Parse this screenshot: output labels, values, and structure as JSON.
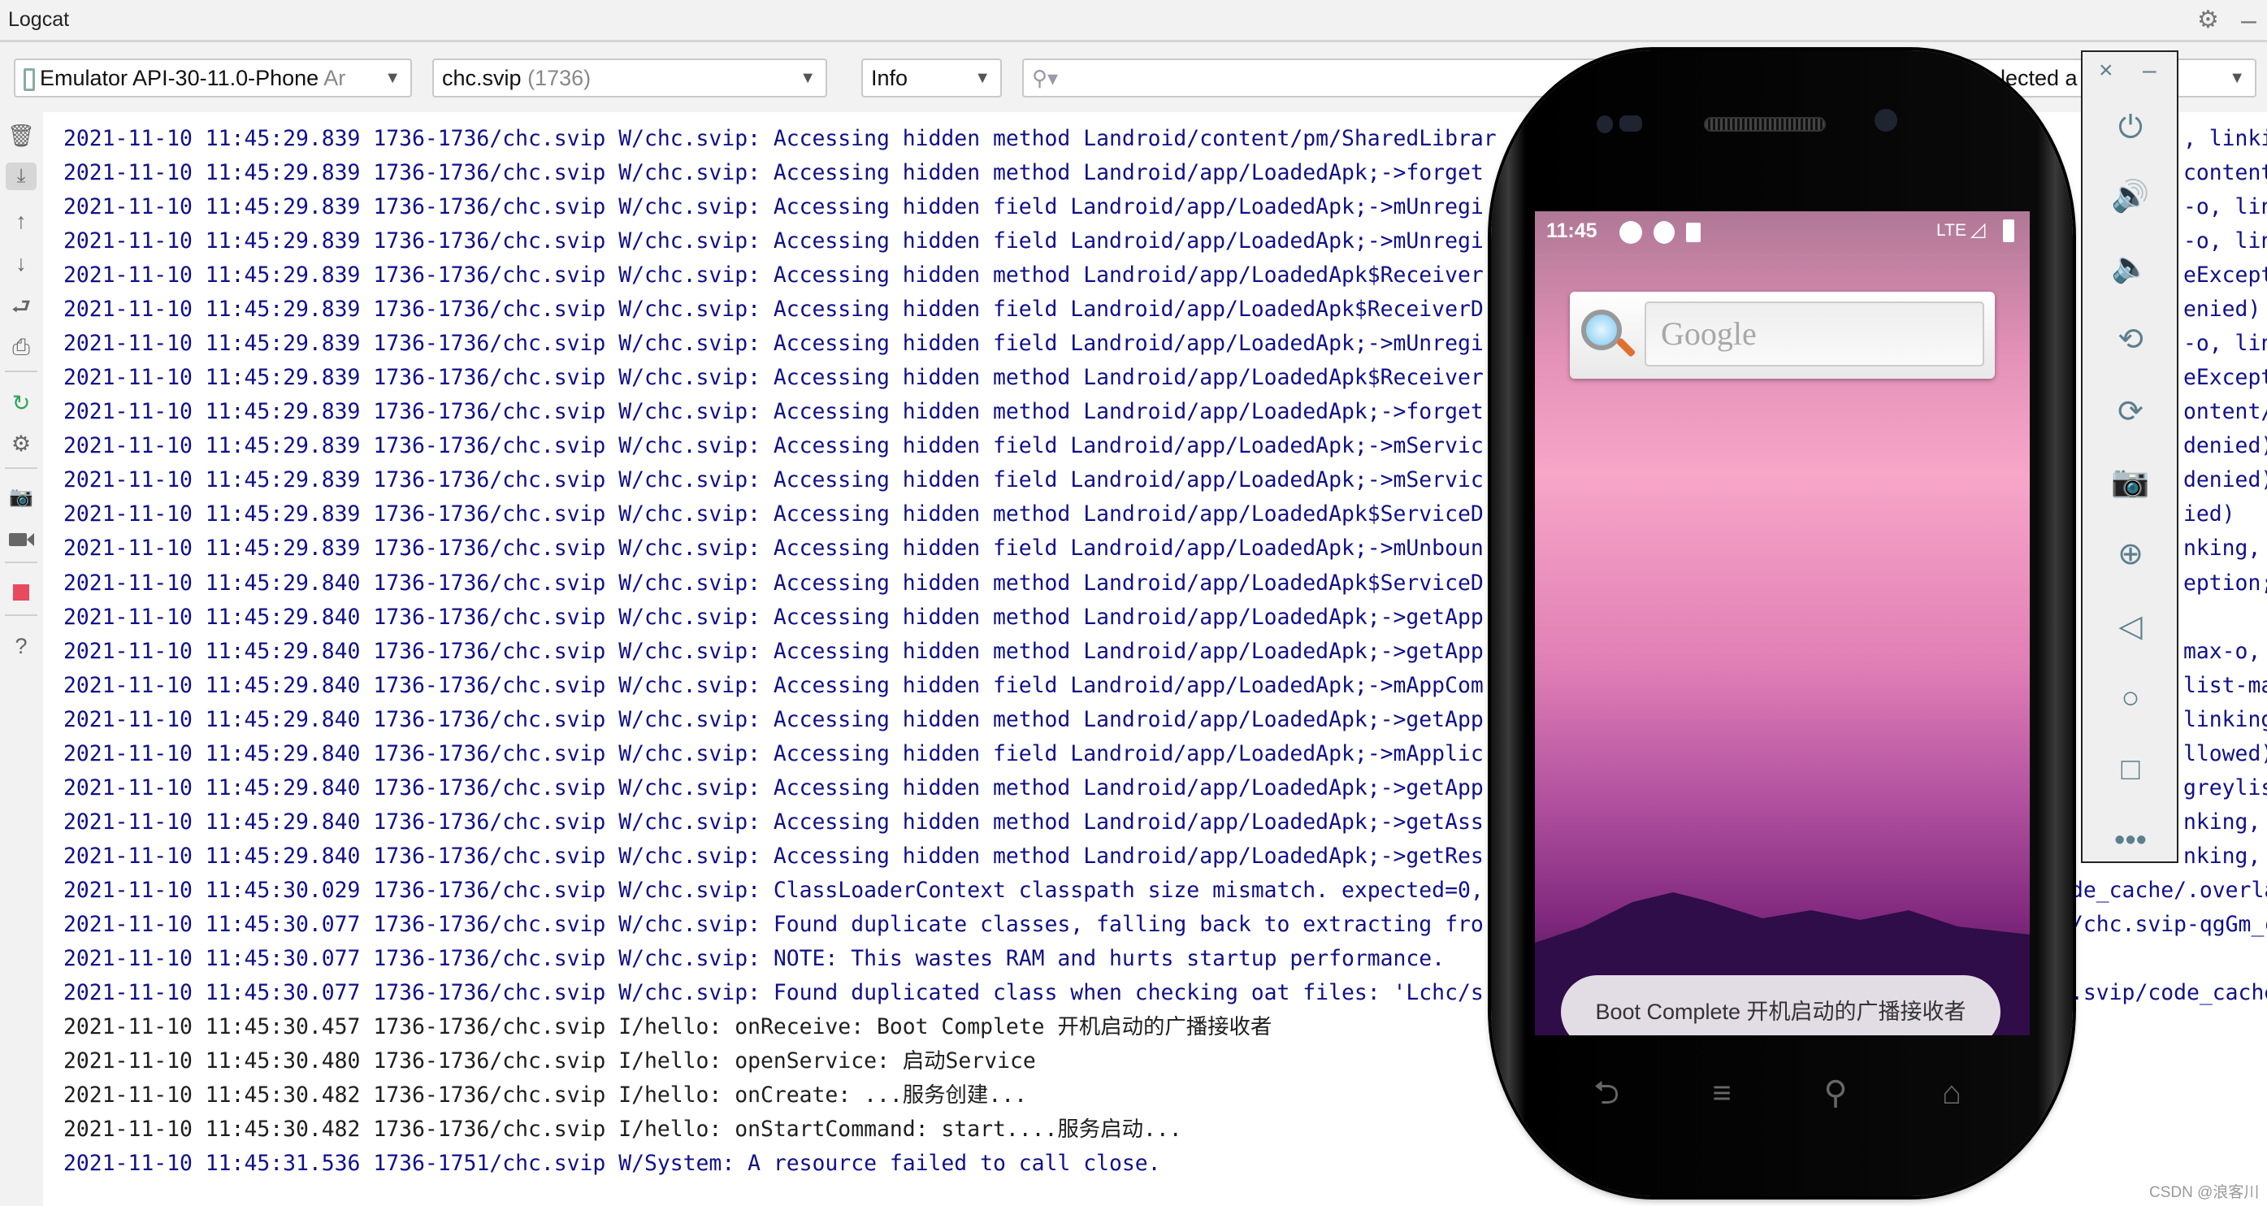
{
  "window": {
    "title": "Logcat"
  },
  "toolbar": {
    "device": {
      "name": "Emulator API-30-11.0-Phone",
      "suffix": "Ar"
    },
    "process": {
      "name": "chc.svip",
      "pid": "(1736)"
    },
    "level": "Info",
    "search": {
      "value": "",
      "placeholder": ""
    },
    "filter": {
      "visible_text": "lected a"
    }
  },
  "log": {
    "colors": {
      "warn": "#10108a",
      "info": "#1e1e1e"
    },
    "lines": [
      {
        "level": "W",
        "text": "2021-11-10 11:45:29.839 1736-1736/chc.svip W/chc.svip: Accessing hidden method Landroid/content/pm/SharedLibrar",
        "right": ", linki"
      },
      {
        "level": "W",
        "text": "2021-11-10 11:45:29.839 1736-1736/chc.svip W/chc.svip: Accessing hidden method Landroid/app/LoadedApk;->forget",
        "right": "content"
      },
      {
        "level": "W",
        "text": "2021-11-10 11:45:29.839 1736-1736/chc.svip W/chc.svip: Accessing hidden field Landroid/app/LoadedApk;->mUnregi",
        "right": "-o, lin"
      },
      {
        "level": "W",
        "text": "2021-11-10 11:45:29.839 1736-1736/chc.svip W/chc.svip: Accessing hidden field Landroid/app/LoadedApk;->mUnregi",
        "right": "-o, lin"
      },
      {
        "level": "W",
        "text": "2021-11-10 11:45:29.839 1736-1736/chc.svip W/chc.svip: Accessing hidden method Landroid/app/LoadedApk$Receiver",
        "right": "eExcepti"
      },
      {
        "level": "W",
        "text": "2021-11-10 11:45:29.839 1736-1736/chc.svip W/chc.svip: Accessing hidden field Landroid/app/LoadedApk$ReceiverD",
        "right": "enied)"
      },
      {
        "level": "W",
        "text": "2021-11-10 11:45:29.839 1736-1736/chc.svip W/chc.svip: Accessing hidden field Landroid/app/LoadedApk;->mUnregi",
        "right": "-o, lin"
      },
      {
        "level": "W",
        "text": "2021-11-10 11:45:29.839 1736-1736/chc.svip W/chc.svip: Accessing hidden method Landroid/app/LoadedApk$Receiver",
        "right": "eExcept"
      },
      {
        "level": "W",
        "text": "2021-11-10 11:45:29.839 1736-1736/chc.svip W/chc.svip: Accessing hidden method Landroid/app/LoadedApk;->forget",
        "right": "ontent/"
      },
      {
        "level": "W",
        "text": "2021-11-10 11:45:29.839 1736-1736/chc.svip W/chc.svip: Accessing hidden field Landroid/app/LoadedApk;->mServic",
        "right": "denied)"
      },
      {
        "level": "W",
        "text": "2021-11-10 11:45:29.839 1736-1736/chc.svip W/chc.svip: Accessing hidden field Landroid/app/LoadedApk;->mServic",
        "right": "denied)"
      },
      {
        "level": "W",
        "text": "2021-11-10 11:45:29.839 1736-1736/chc.svip W/chc.svip: Accessing hidden method Landroid/app/LoadedApk$ServiceD",
        "right": "ied)"
      },
      {
        "level": "W",
        "text": "2021-11-10 11:45:29.839 1736-1736/chc.svip W/chc.svip: Accessing hidden field Landroid/app/LoadedApk;->mUnboun",
        "right": "nking,"
      },
      {
        "level": "W",
        "text": "2021-11-10 11:45:29.840 1736-1736/chc.svip W/chc.svip: Accessing hidden method Landroid/app/LoadedApk$ServiceD",
        "right": "eption;"
      },
      {
        "level": "W",
        "text": "2021-11-10 11:45:29.840 1736-1736/chc.svip W/chc.svip: Accessing hidden method Landroid/app/LoadedApk;->getApp",
        "right": ""
      },
      {
        "level": "W",
        "text": "2021-11-10 11:45:29.840 1736-1736/chc.svip W/chc.svip: Accessing hidden method Landroid/app/LoadedApk;->getApp",
        "right": "max-o,"
      },
      {
        "level": "W",
        "text": "2021-11-10 11:45:29.840 1736-1736/chc.svip W/chc.svip: Accessing hidden field Landroid/app/LoadedApk;->mAppCom",
        "right": "list-ma"
      },
      {
        "level": "W",
        "text": "2021-11-10 11:45:29.840 1736-1736/chc.svip W/chc.svip: Accessing hidden method Landroid/app/LoadedApk;->getApp",
        "right": "linking"
      },
      {
        "level": "W",
        "text": "2021-11-10 11:45:29.840 1736-1736/chc.svip W/chc.svip: Accessing hidden field Landroid/app/LoadedApk;->mApplic",
        "right": "llowed)"
      },
      {
        "level": "W",
        "text": "2021-11-10 11:45:29.840 1736-1736/chc.svip W/chc.svip: Accessing hidden method Landroid/app/LoadedApk;->getApp",
        "right": "greylist"
      },
      {
        "level": "W",
        "text": "2021-11-10 11:45:29.840 1736-1736/chc.svip W/chc.svip: Accessing hidden method Landroid/app/LoadedApk;->getAss",
        "right": "nking,"
      },
      {
        "level": "W",
        "text": "2021-11-10 11:45:29.840 1736-1736/chc.svip W/chc.svip: Accessing hidden method Landroid/app/LoadedApk;->getRes",
        "right": "nking,"
      },
      {
        "level": "W",
        "text": "2021-11-10 11:45:30.029 1736-1736/chc.svip W/chc.svip: ClassLoaderContext classpath size mismatch. expected=0,",
        "right": "de_cache/.overla",
        "wide": true
      },
      {
        "level": "W",
        "text": "2021-11-10 11:45:30.077 1736-1736/chc.svip W/chc.svip: Found duplicate classes, falling back to extracting fro",
        "right": "/chc.svip-qgGm_c",
        "wide": true
      },
      {
        "level": "W",
        "text": "2021-11-10 11:45:30.077 1736-1736/chc.svip W/chc.svip: NOTE: This wastes RAM and hurts startup performance.",
        "right": ""
      },
      {
        "level": "W",
        "text": "2021-11-10 11:45:30.077 1736-1736/chc.svip W/chc.svip: Found duplicated class when checking oat files: 'Lchc/s",
        "right": ".svip/code_cache",
        "wide": true
      },
      {
        "level": "I",
        "text": "2021-11-10 11:45:30.457 1736-1736/chc.svip I/hello: onReceive: Boot Complete 开机启动的广播接收者",
        "right": ""
      },
      {
        "level": "I",
        "text": "2021-11-10 11:45:30.480 1736-1736/chc.svip I/hello: openService: 启动Service",
        "right": ""
      },
      {
        "level": "I",
        "text": "2021-11-10 11:45:30.482 1736-1736/chc.svip I/hello: onCreate: ...服务创建...",
        "right": ""
      },
      {
        "level": "I",
        "text": "2021-11-10 11:45:30.482 1736-1736/chc.svip I/hello: onStartCommand: start....服务启动...",
        "right": ""
      },
      {
        "level": "W",
        "text": "2021-11-10 11:45:31.536 1736-1751/chc.svip W/System: A resource failed to call close.",
        "right": ""
      }
    ]
  },
  "left_toolbar": {
    "icons": [
      "trash-icon",
      "scroll-to-end-icon",
      "up-arrow-icon",
      "down-arrow-icon",
      "soft-wrap-icon",
      "print-icon",
      "restart-icon",
      "settings-icon",
      "screenshot-icon",
      "screen-record-icon",
      "stop-icon",
      "help-icon"
    ]
  },
  "emulator": {
    "status": {
      "time": "11:45",
      "network": "LTE"
    },
    "search_widget": {
      "placeholder": "Google"
    },
    "toast": "Boot Complete 开机启动的广播接收者",
    "toolbar_icons": [
      "power-icon",
      "volume-up-icon",
      "volume-down-icon",
      "rotate-left-icon",
      "rotate-right-icon",
      "camera-icon",
      "zoom-icon",
      "back-icon",
      "home-icon",
      "overview-icon",
      "more-icon"
    ],
    "toolbar_color": "#5b7f8d",
    "close_label": "×",
    "minimize_label": "–"
  },
  "watermark": "CSDN @浪客川"
}
